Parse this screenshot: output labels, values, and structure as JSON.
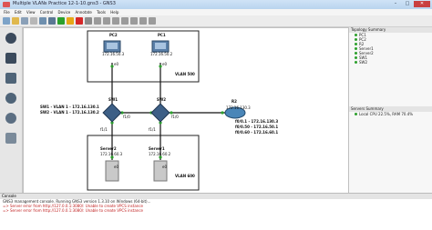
{
  "window": {
    "title": "Multiple VLANs Practice 12-1-10.gns3 - GNS3"
  },
  "menu": [
    "File",
    "Edit",
    "View",
    "Control",
    "Device",
    "Annotate",
    "Tools",
    "Help"
  ],
  "canvas": {
    "pc2": {
      "name": "PC2",
      "ip": "172.16.50.3",
      "port": "e0"
    },
    "pc1": {
      "name": "PC1",
      "ip": "172.16.50.2",
      "port": "e0"
    },
    "vlan500": "VLAN 500",
    "sw1": {
      "name": "SW1"
    },
    "sw2": {
      "name": "SW2"
    },
    "sw_notes": [
      "SW1 - VLAN 1 - 172.16.130.1",
      "SW2 - VLAN 1 - 172.16.130.2"
    ],
    "f1_0_a": "f1/0",
    "f1_0_b": "f1/0",
    "r2": {
      "name": "R2",
      "ip": "172.16.130.3",
      "subifs": [
        "f0/0.1 - 172.16.130.3",
        "f0/0.50 - 172.16.50.1",
        "f0/0.60 - 172.16.60.1"
      ]
    },
    "f1_1_a": "f1/1",
    "f1_1_b": "f1/1",
    "server2": {
      "name": "Server2",
      "ip": "172.16.60.3",
      "port": "e0"
    },
    "server1": {
      "name": "Server1",
      "ip": "172.16.60.2",
      "port": "e0"
    },
    "vlan600": "VLAN 600"
  },
  "topology": {
    "title": "Topology Summary",
    "items": [
      "PC1",
      "PC2",
      "R2",
      "Server1",
      "Server2",
      "SW1",
      "SW2"
    ]
  },
  "servers": {
    "title": "Servers Summary",
    "items": [
      "Local CPU 22.5%, RAM 70.4%"
    ]
  },
  "console": {
    "title": "Console",
    "lines": [
      "GNS3 management console. Running GNS3 version 1.3.10 on Windows (64-bit)...",
      "=> Server error from http://127.0.0.1:3080/: Unable to create VPCS instance",
      "=> Server error from http://127.0.0.1:3080/: Unable to create VPCS instance"
    ]
  }
}
